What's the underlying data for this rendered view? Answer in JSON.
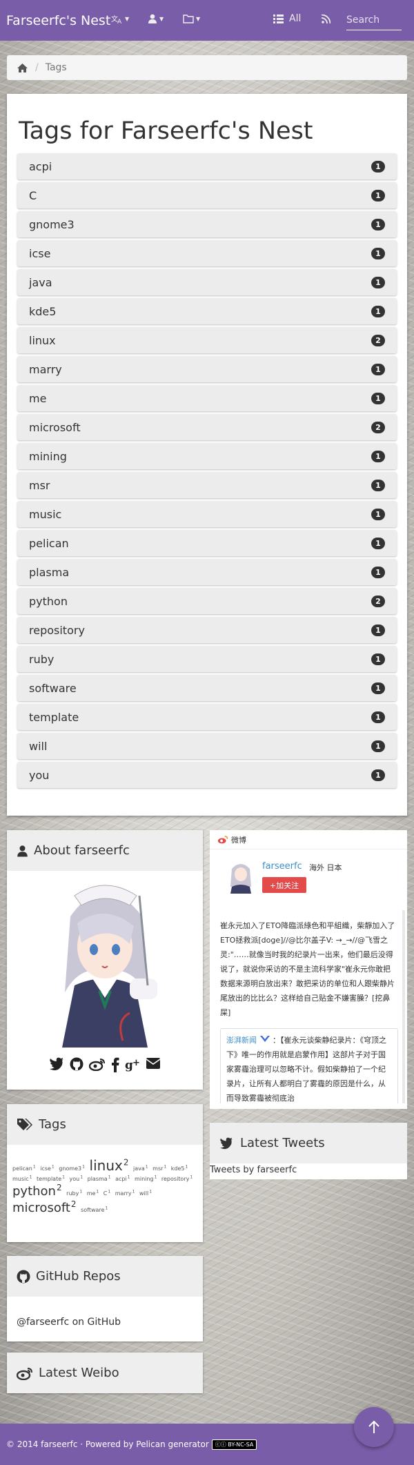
{
  "navbar": {
    "brand": "Farseerfc's Nest",
    "all_label": "All",
    "search_placeholder": "Search"
  },
  "breadcrumb": {
    "current": "Tags"
  },
  "main": {
    "title": "Tags for Farseerfc's Nest",
    "tags": [
      {
        "name": "acpi",
        "count": "1"
      },
      {
        "name": "C",
        "count": "1"
      },
      {
        "name": "gnome3",
        "count": "1"
      },
      {
        "name": "icse",
        "count": "1"
      },
      {
        "name": "java",
        "count": "1"
      },
      {
        "name": "kde5",
        "count": "1"
      },
      {
        "name": "linux",
        "count": "2"
      },
      {
        "name": "marry",
        "count": "1"
      },
      {
        "name": "me",
        "count": "1"
      },
      {
        "name": "microsoft",
        "count": "2"
      },
      {
        "name": "mining",
        "count": "1"
      },
      {
        "name": "msr",
        "count": "1"
      },
      {
        "name": "music",
        "count": "1"
      },
      {
        "name": "pelican",
        "count": "1"
      },
      {
        "name": "plasma",
        "count": "1"
      },
      {
        "name": "python",
        "count": "2"
      },
      {
        "name": "repository",
        "count": "1"
      },
      {
        "name": "ruby",
        "count": "1"
      },
      {
        "name": "software",
        "count": "1"
      },
      {
        "name": "template",
        "count": "1"
      },
      {
        "name": "will",
        "count": "1"
      },
      {
        "name": "you",
        "count": "1"
      }
    ]
  },
  "about": {
    "title": "About farseerfc"
  },
  "tagcloud": {
    "title": "Tags",
    "items": [
      {
        "name": "pelican",
        "count": "1",
        "size": "small"
      },
      {
        "name": "icse",
        "count": "1",
        "size": "small"
      },
      {
        "name": "gnome3",
        "count": "1",
        "size": "small"
      },
      {
        "name": "linux",
        "count": "2",
        "size": "big"
      },
      {
        "name": "java",
        "count": "1",
        "size": "small"
      },
      {
        "name": "msr",
        "count": "1",
        "size": "small"
      },
      {
        "name": "kde5",
        "count": "1",
        "size": "small"
      },
      {
        "name": "music",
        "count": "1",
        "size": "small"
      },
      {
        "name": "template",
        "count": "1",
        "size": "small"
      },
      {
        "name": "you",
        "count": "1",
        "size": "small"
      },
      {
        "name": "plasma",
        "count": "1",
        "size": "small"
      },
      {
        "name": "acpi",
        "count": "1",
        "size": "small"
      },
      {
        "name": "mining",
        "count": "1",
        "size": "small"
      },
      {
        "name": "repository",
        "count": "1",
        "size": "small"
      },
      {
        "name": "python",
        "count": "2",
        "size": "mid"
      },
      {
        "name": "ruby",
        "count": "1",
        "size": "small"
      },
      {
        "name": "me",
        "count": "1",
        "size": "small"
      },
      {
        "name": "C",
        "count": "1",
        "size": "small"
      },
      {
        "name": "marry",
        "count": "1",
        "size": "small"
      },
      {
        "name": "will",
        "count": "1",
        "size": "small"
      },
      {
        "name": "microsoft",
        "count": "2",
        "size": "mid"
      },
      {
        "name": "software",
        "count": "1",
        "size": "small"
      }
    ]
  },
  "github": {
    "title": "GitHub Repos",
    "link_text": "@farseerfc on GitHub"
  },
  "latest_weibo": {
    "title": "Latest Weibo"
  },
  "weibo": {
    "header": "微博",
    "name": "farseerfc",
    "location": "海外 日本",
    "follow": "+加关注",
    "post": "崔永元加入了ETO降臨派綠色和平組織，柴靜加入了ETO拯救派[doge]//@比尔盖子V: →_→//@飞雪之灵:\"……就像当时我的纪录片一出来，他们最后没得说了，就说你采访的不是主流科学家\"崔永元你敢把数据来源明白放出来？敢把采访的单位和人跟柴静片尾放出的比比么？这样给自己贴金不嫌害臊？[挖鼻屎]",
    "repost_name": "澎湃新闻",
    "repost_text": "：【崔永元谈柴静纪录片：《穹顶之下》唯一的作用就是启蒙作用】这部片子对于国家雾霾治理可以忽略不计。假如柴静拍了一个纪录片，让所有人都明白了雾霾的原因是什么，从而导致雾霾被彻底治"
  },
  "twitter": {
    "title": "Latest Tweets",
    "tweets_by": "Tweets by farseerfc"
  },
  "footer": {
    "text": "© 2014 farseerfc · Powered by Pelican generator",
    "license": "BY-NC-SA"
  },
  "colors": {
    "brand": "#7a5da8",
    "badge": "#333333",
    "follow": "#e34a4a",
    "link": "#3d8ec9"
  },
  "icons": [
    "language-icon",
    "user-icon",
    "folder-icon",
    "list-icon",
    "rss-icon",
    "home-icon",
    "weibo-icon",
    "twitter-icon",
    "github-icon",
    "facebook-icon",
    "google-plus-icon",
    "mail-icon",
    "tags-icon",
    "arrow-up-icon"
  ]
}
